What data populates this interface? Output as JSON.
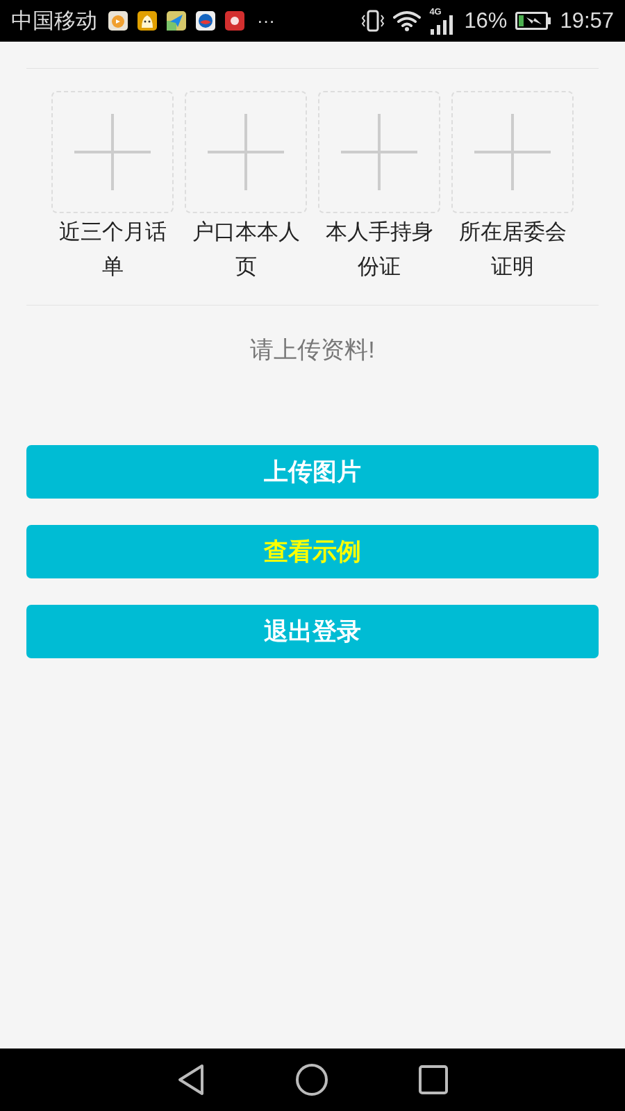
{
  "status_bar": {
    "carrier": "中国移动",
    "more": "···",
    "network": "4G",
    "battery_percent": "16%",
    "time": "19:57"
  },
  "uploads": [
    {
      "label": "近三个月话单"
    },
    {
      "label": "户口本本人页"
    },
    {
      "label": "本人手持身份证"
    },
    {
      "label": "所在居委会证明"
    }
  ],
  "message": "请上传资料!",
  "buttons": [
    {
      "label": "上传图片",
      "kind": "plain"
    },
    {
      "label": "查看示例",
      "kind": "highlight"
    },
    {
      "label": "退出登录",
      "kind": "plain"
    }
  ]
}
